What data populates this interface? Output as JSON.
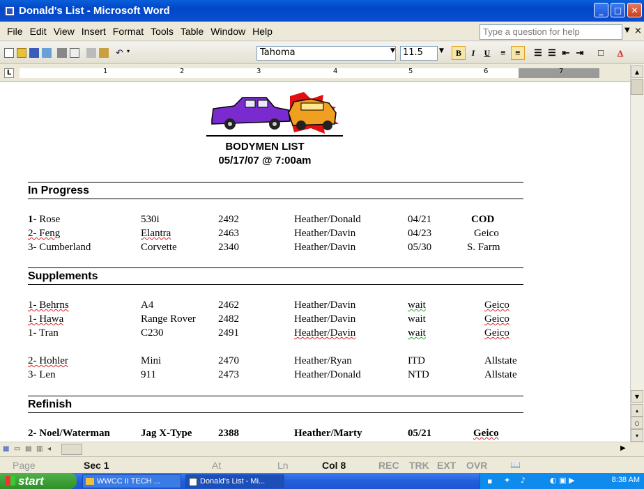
{
  "window": {
    "title": "Donald's List - Microsoft Word"
  },
  "menu": [
    "File",
    "Edit",
    "View",
    "Insert",
    "Format",
    "Tools",
    "Table",
    "Window",
    "Help"
  ],
  "ask_box": {
    "placeholder": "Type a question for help"
  },
  "toolbar": {
    "font_name": "Tahoma",
    "font_size": "11.5"
  },
  "ruler": {
    "numbers": [
      "1",
      "2",
      "3",
      "4",
      "5",
      "6",
      "7"
    ]
  },
  "document": {
    "title": "BODYMEN LIST",
    "date": "05/17/07 @ 7:00am",
    "sections": [
      {
        "name": "In Progress",
        "rows": [
          [
            "1- Rose",
            "530i",
            "2492",
            "Heather/Donald",
            "04/21",
            "COD"
          ],
          [
            "2- Feng",
            "Elantra",
            "2463",
            "Heather/Davin",
            "04/23",
            "Geico"
          ],
          [
            "3- Cumberland",
            "Corvette",
            "2340",
            "Heather/Davin",
            "05/30",
            "S. Farm"
          ]
        ]
      },
      {
        "name": "Supplements",
        "rows": [
          [
            "1- Behrns",
            "A4",
            "2462",
            "Heather/Davin",
            "wait",
            "Geico"
          ],
          [
            "1- Hawa",
            "Range Rover",
            "2482",
            "Heather/Davin",
            "wait",
            "Geico"
          ],
          [
            "1- Tran",
            "C230",
            "2491",
            "Heather/Davin",
            "wait",
            "Geico"
          ],
          [
            "2- Hohler",
            "Mini",
            "2470",
            "Heather/Ryan",
            "ITD",
            "Allstate"
          ],
          [
            "3- Len",
            "911",
            "2473",
            "Heather/Donald",
            "NTD",
            "Allstate"
          ]
        ]
      },
      {
        "name": "Refinish",
        "rows": [
          [
            "2- Noel/Waterman",
            "Jag X-Type",
            "2388",
            "Heather/Marty",
            "05/21",
            "Geico"
          ]
        ]
      }
    ]
  },
  "status": {
    "page": "Page",
    "sec": "Sec 1",
    "at": "At",
    "ln": "Ln",
    "col": "Col 8",
    "rec": "REC",
    "trk": "TRK",
    "ext": "EXT",
    "ovr": "OVR"
  },
  "taskbar": {
    "start": "start",
    "task1": "WWCC II TECH ...",
    "task2": "Donald's List - Mi...",
    "clock": "8:38 AM"
  }
}
